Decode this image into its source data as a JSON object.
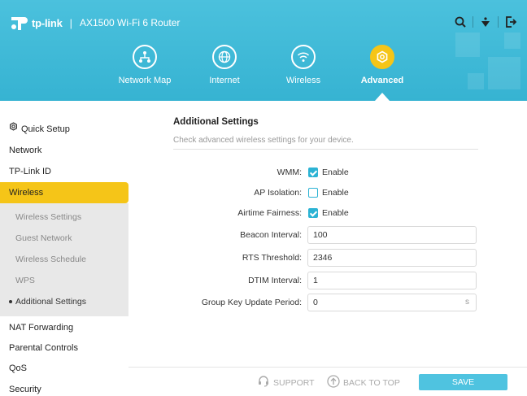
{
  "header": {
    "brand": "tp-link",
    "separator": "|",
    "model": "AX1500 Wi-Fi 6 Router",
    "icons": [
      "search-icon",
      "bulb-icon",
      "logout-icon"
    ],
    "nav": [
      {
        "label": "Network Map",
        "icon": "network-map-icon",
        "active": false
      },
      {
        "label": "Internet",
        "icon": "globe-icon",
        "active": false
      },
      {
        "label": "Wireless",
        "icon": "wifi-icon",
        "active": false
      },
      {
        "label": "Advanced",
        "icon": "gear-icon",
        "active": true
      }
    ],
    "colors": {
      "bar": "#3db8d6",
      "accent": "#f5c518"
    }
  },
  "sidebar": {
    "items": [
      {
        "label": "Quick Setup",
        "icon": "gear-icon"
      },
      {
        "label": "Network"
      },
      {
        "label": "TP-Link ID"
      },
      {
        "label": "Wireless",
        "active": true
      },
      {
        "label": "NAT Forwarding"
      },
      {
        "label": "Parental Controls"
      },
      {
        "label": "QoS"
      },
      {
        "label": "Security"
      }
    ],
    "subitems": [
      {
        "label": "Wireless Settings"
      },
      {
        "label": "Guest Network"
      },
      {
        "label": "Wireless Schedule"
      },
      {
        "label": "WPS"
      },
      {
        "label": "Additional Settings",
        "active": true
      }
    ]
  },
  "main": {
    "title": "Additional Settings",
    "description": "Check advanced wireless settings for your device.",
    "checkboxes": [
      {
        "label": "WMM:",
        "option": "Enable",
        "checked": true
      },
      {
        "label": "AP Isolation:",
        "option": "Enable",
        "checked": false
      },
      {
        "label": "Airtime Fairness:",
        "option": "Enable",
        "checked": true
      }
    ],
    "fields": [
      {
        "label": "Beacon Interval:",
        "value": "100"
      },
      {
        "label": "RTS Threshold:",
        "value": "2346"
      },
      {
        "label": "DTIM Interval:",
        "value": "1"
      },
      {
        "label": "Group Key Update Period:",
        "value": "0",
        "unit": "s"
      }
    ]
  },
  "footer": {
    "support": "SUPPORT",
    "back_to_top": "BACK TO TOP",
    "save": "SAVE"
  }
}
